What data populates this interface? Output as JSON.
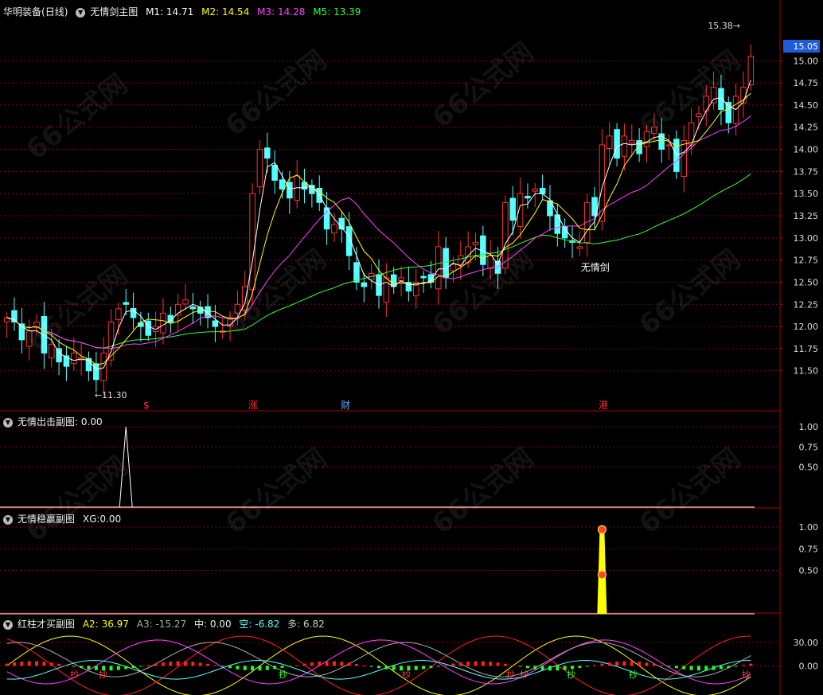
{
  "header": {
    "stock_name": "华明装备",
    "period": "(日线)",
    "main_indicator": "无情剑主图",
    "m1_label": "M1:",
    "m1": "14.71",
    "m2_label": "M2:",
    "m2": "14.54",
    "m3_label": "M3:",
    "m3": "14.28",
    "m5_label": "M5:",
    "m5": "13.39"
  },
  "colors": {
    "up": "#ff3030",
    "down": "#54ffff",
    "m1": "#ffffff",
    "m2": "#ffff00",
    "m3": "#ff40ff",
    "m5": "#33ff33",
    "grid": "#8b0000",
    "axis": "#aa0000"
  },
  "price_labels": {
    "high": "15.38",
    "low": "11.30",
    "current": "15.05",
    "signal": "无情剑"
  },
  "bottom_markers": [
    "$",
    "涨",
    "财",
    "港"
  ],
  "sub1": {
    "title": "无情出击副图",
    "value": ": 0.00"
  },
  "sub2": {
    "title": "无情稳赢副图",
    "label": "XG:",
    "value": "0.00"
  },
  "sub3": {
    "title": "红柱才买副图",
    "a2_label": "A2:",
    "a2": "36.97",
    "a3_label": "A3:",
    "a3": "-15.27",
    "mid_label": "中:",
    "mid": "0.00",
    "empty_label": "空:",
    "empty": "-6.82",
    "many_label": "多:",
    "many": "6.82",
    "buy_glyph": "抄"
  },
  "watermark": "66公式网",
  "chart_data": [
    {
      "type": "candlestick",
      "title": "无情剑主图",
      "ylim": [
        11.3,
        15.38
      ],
      "y_ticks": [
        11.5,
        11.75,
        12.0,
        12.25,
        12.5,
        12.75,
        13.0,
        13.25,
        13.5,
        13.75,
        14.0,
        14.25,
        14.5,
        14.75,
        15.0
      ],
      "y_tick_labels": [
        "11.50",
        "11.75",
        "12.00",
        "12.25",
        "12.50",
        "12.75",
        "13.00",
        "13.25",
        "13.50",
        "13.75",
        "14.00",
        "14.25",
        "14.50",
        "14.75",
        "15.00"
      ],
      "close": [
        12.1,
        12.05,
        11.85,
        11.95,
        12.05,
        11.7,
        11.8,
        11.6,
        11.55,
        11.7,
        11.65,
        11.5,
        11.4,
        11.7,
        12.05,
        12.2,
        12.25,
        12.1,
        12.0,
        11.9,
        12.0,
        12.15,
        12.05,
        12.25,
        12.3,
        12.2,
        12.15,
        12.1,
        12.0,
        11.95,
        12.1,
        12.25,
        12.45,
        13.5,
        14.0,
        13.9,
        13.65,
        13.55,
        13.45,
        13.7,
        13.55,
        13.5,
        13.4,
        13.1,
        13.15,
        13.1,
        12.8,
        12.5,
        12.45,
        12.6,
        12.35,
        12.55,
        12.45,
        12.55,
        12.4,
        12.5,
        12.55,
        12.5,
        12.9,
        12.55,
        12.7,
        12.8,
        12.9,
        12.95,
        12.7,
        12.8,
        12.6,
        13.4,
        13.2,
        13.5,
        13.45,
        13.55,
        13.5,
        13.25,
        13.05,
        13.0,
        12.95,
        12.9,
        13.4,
        13.25,
        14.05,
        14.15,
        13.9,
        14.15,
        14.1,
        13.95,
        14.2,
        14.25,
        14.0,
        14.05,
        13.75,
        14.1,
        14.3,
        14.4,
        14.6,
        14.7,
        14.45,
        14.3,
        14.6,
        14.7,
        15.05
      ],
      "ohlc_note": "ohlc derived by script from close"
    },
    {
      "type": "line",
      "title": "无情出击副图",
      "ylim": [
        0,
        1
      ],
      "y_ticks": [
        "0.50",
        "0.75",
        "1.00"
      ],
      "signal_index": 16,
      "signal_value": 1.0
    },
    {
      "type": "bar",
      "title": "无情稳赢副图",
      "ylim": [
        0,
        1
      ],
      "y_ticks": [
        "0.50",
        "0.75",
        "1.00"
      ],
      "signal_index": 80,
      "signal_value": 1.0
    },
    {
      "type": "line",
      "title": "红柱才买副图",
      "y_ticks": [
        "0.00",
        "30.00"
      ],
      "series": [
        {
          "name": "A2",
          "value": 36.97
        },
        {
          "name": "A3",
          "value": -15.27
        },
        {
          "name": "中",
          "value": 0.0
        },
        {
          "name": "空",
          "value": -6.82
        },
        {
          "name": "多",
          "value": 6.82
        }
      ]
    }
  ]
}
